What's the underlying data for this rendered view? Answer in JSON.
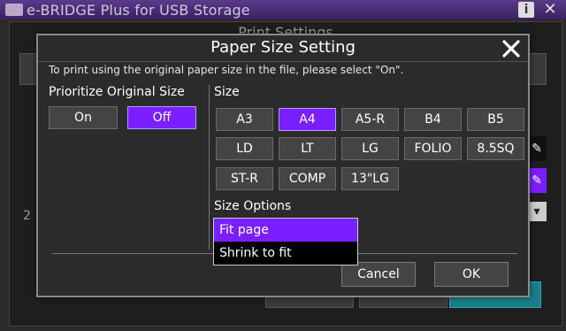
{
  "app": {
    "title": "e-BRIDGE Plus for USB Storage",
    "info_label": "i",
    "close_label": "✕"
  },
  "background": {
    "panel_title": "Print Settings",
    "digit": "2"
  },
  "dialog": {
    "title": "Paper Size Setting",
    "hint": "To print using the original paper size in the file, please select \"On\".",
    "prioritize": {
      "label": "Prioritize Original Size",
      "options": [
        "On",
        "Off"
      ],
      "selected": "Off"
    },
    "size": {
      "label": "Size",
      "rows": [
        [
          "A3",
          "A4",
          "A5-R",
          "B4",
          "B5"
        ],
        [
          "LD",
          "LT",
          "LG",
          "FOLIO",
          "8.5SQ"
        ],
        [
          "ST-R",
          "COMP",
          "13\"LG"
        ]
      ],
      "selected": "A4"
    },
    "size_options": {
      "label": "Size Options",
      "items": [
        "Fit page",
        "Shrink to fit"
      ],
      "selected": "Fit page"
    },
    "cancel_label": "Cancel",
    "ok_label": "OK"
  },
  "colors": {
    "accent": "#7a1fff",
    "titlebar": "#4a2c78"
  }
}
